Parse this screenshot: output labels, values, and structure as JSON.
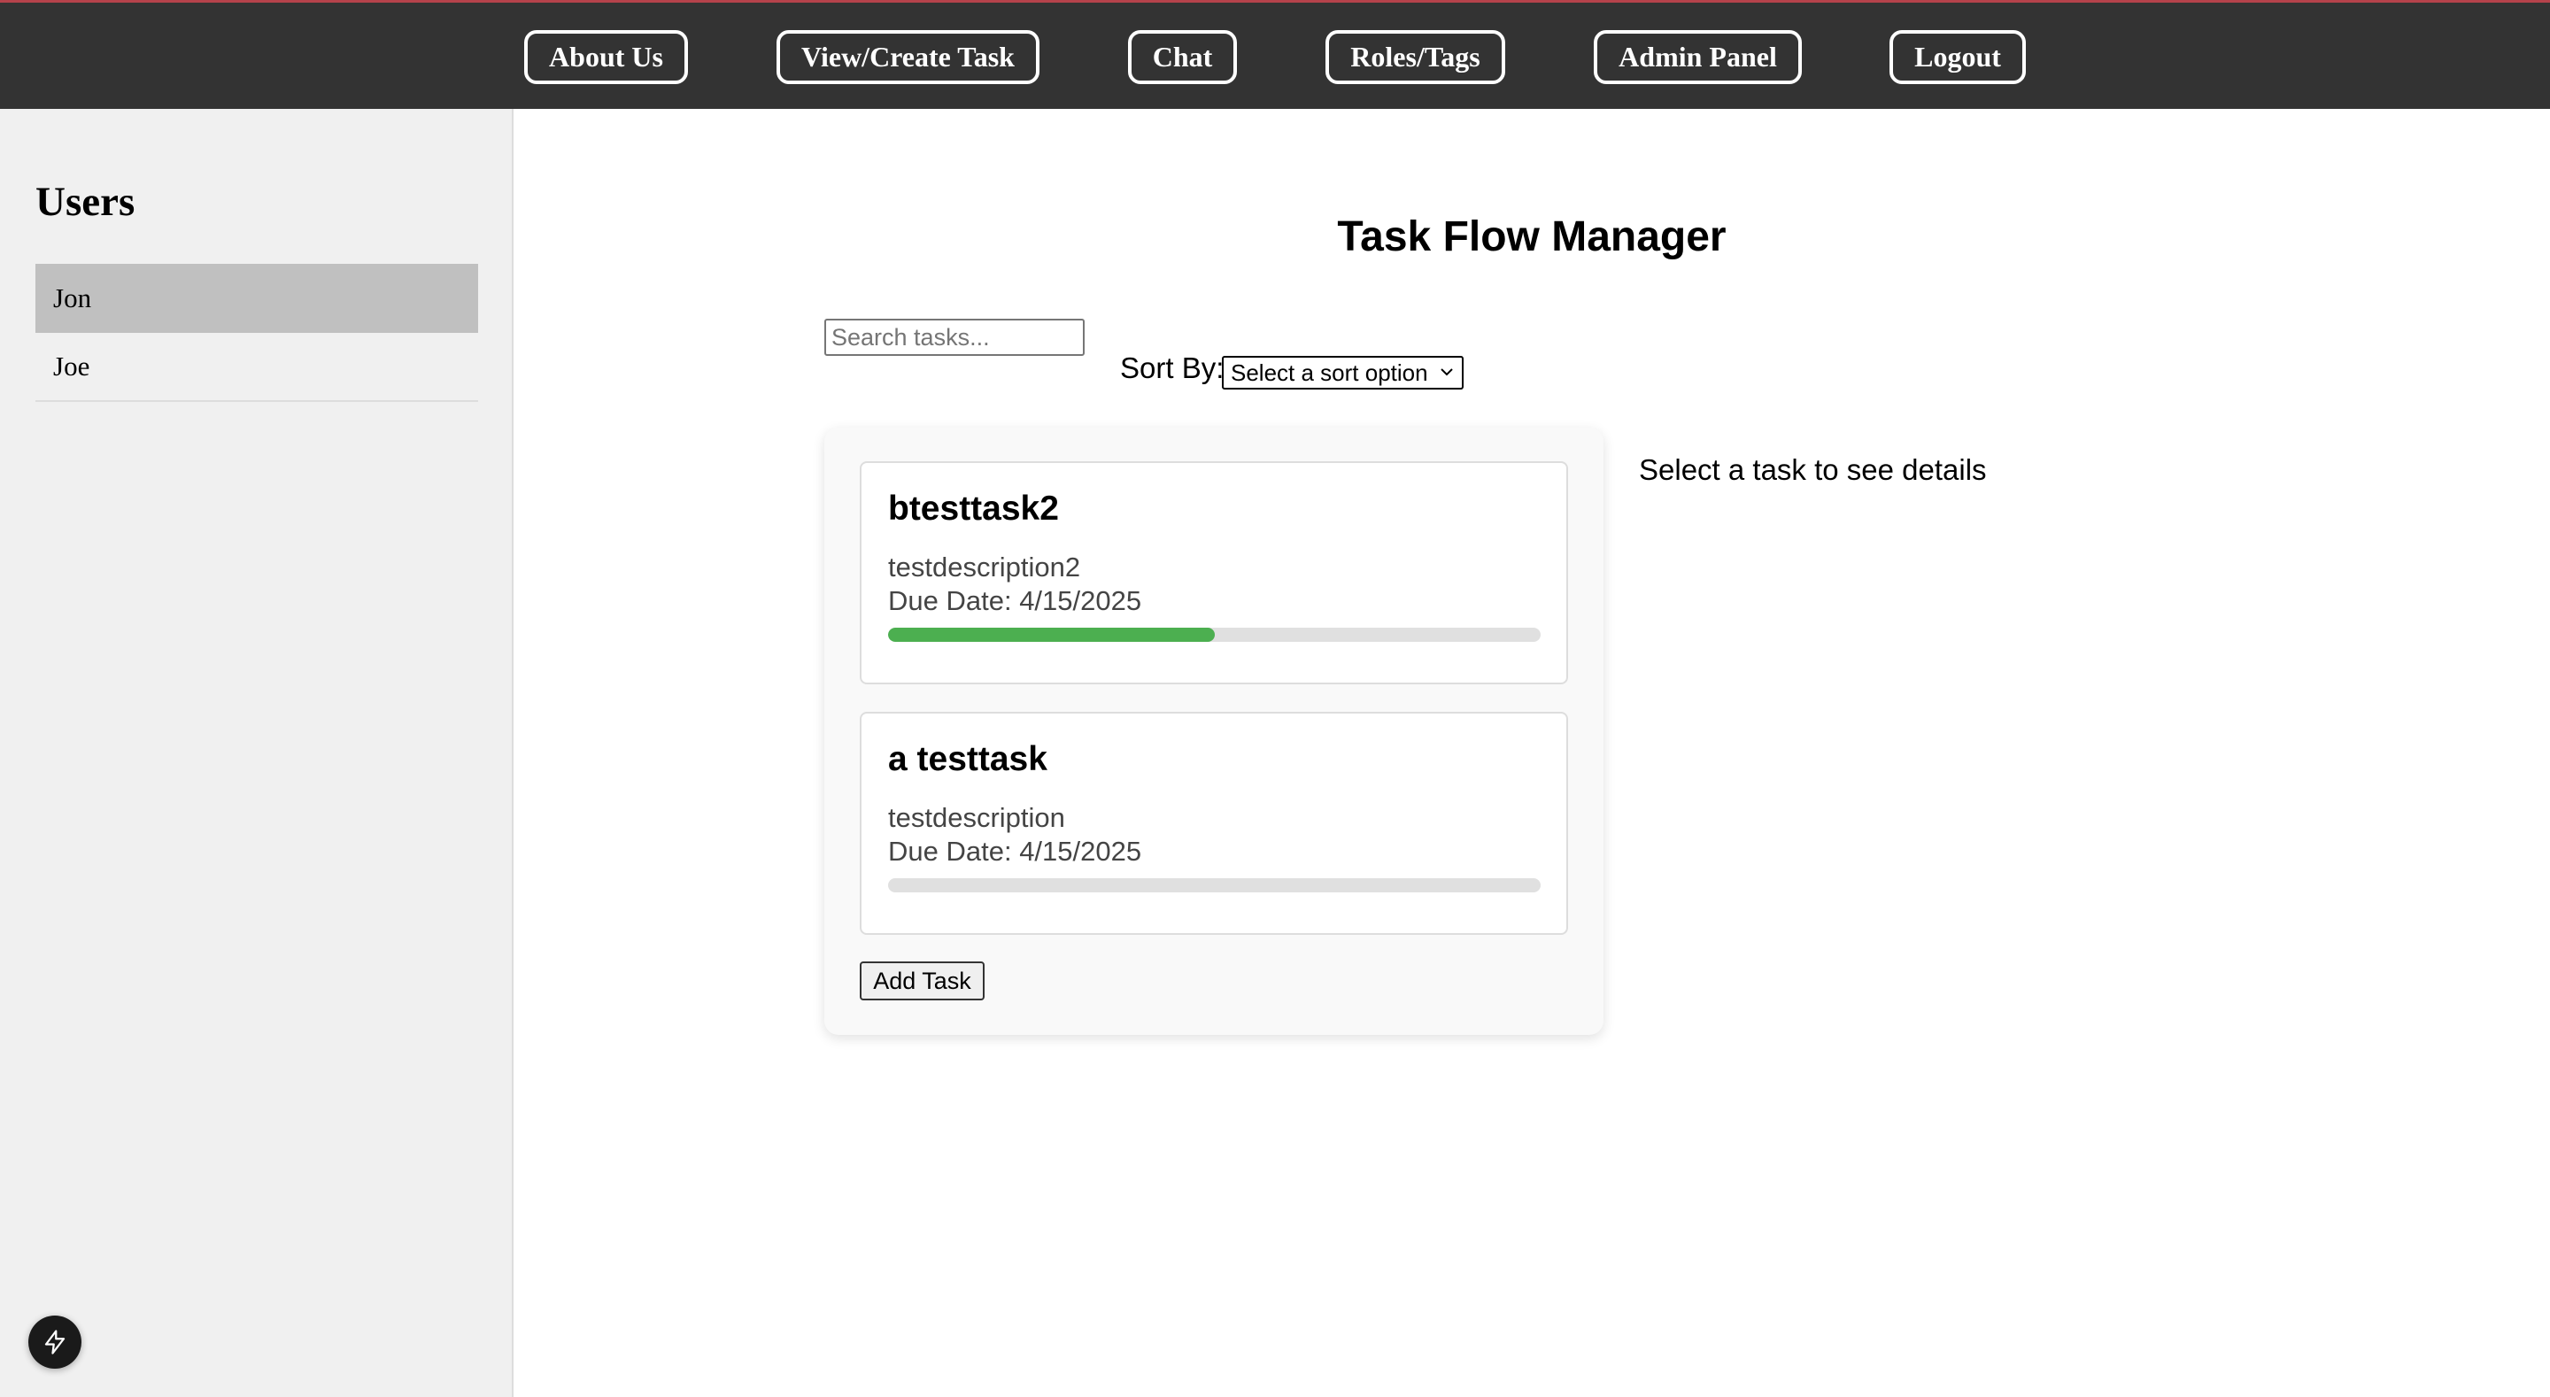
{
  "nav": {
    "items": [
      {
        "label": "About Us"
      },
      {
        "label": "View/Create Task"
      },
      {
        "label": "Chat"
      },
      {
        "label": "Roles/Tags"
      },
      {
        "label": "Admin Panel"
      },
      {
        "label": "Logout"
      }
    ]
  },
  "sidebar": {
    "title": "Users",
    "users": [
      {
        "name": "Jon",
        "selected": true
      },
      {
        "name": "Joe",
        "selected": false
      }
    ]
  },
  "main": {
    "title": "Task Flow Manager",
    "search_placeholder": "Search tasks...",
    "sort_label": "Sort By:",
    "sort_selected": "Select a sort option",
    "details_placeholder": "Select a task to see details",
    "add_task_label": "Add Task",
    "tasks": [
      {
        "title": "btesttask2",
        "description": "testdescription2",
        "due": "Due Date: 4/15/2025",
        "progress": 0.5
      },
      {
        "title": "a testtask",
        "description": "testdescription",
        "due": "Due Date: 4/15/2025",
        "progress": 0
      }
    ]
  },
  "colors": {
    "topbar": "#333333",
    "progress": "#4caf50",
    "selected_user": "#c0c0c0"
  },
  "icons": {
    "fab": "lightning-icon",
    "sort_chevron": "chevron-down-icon"
  }
}
